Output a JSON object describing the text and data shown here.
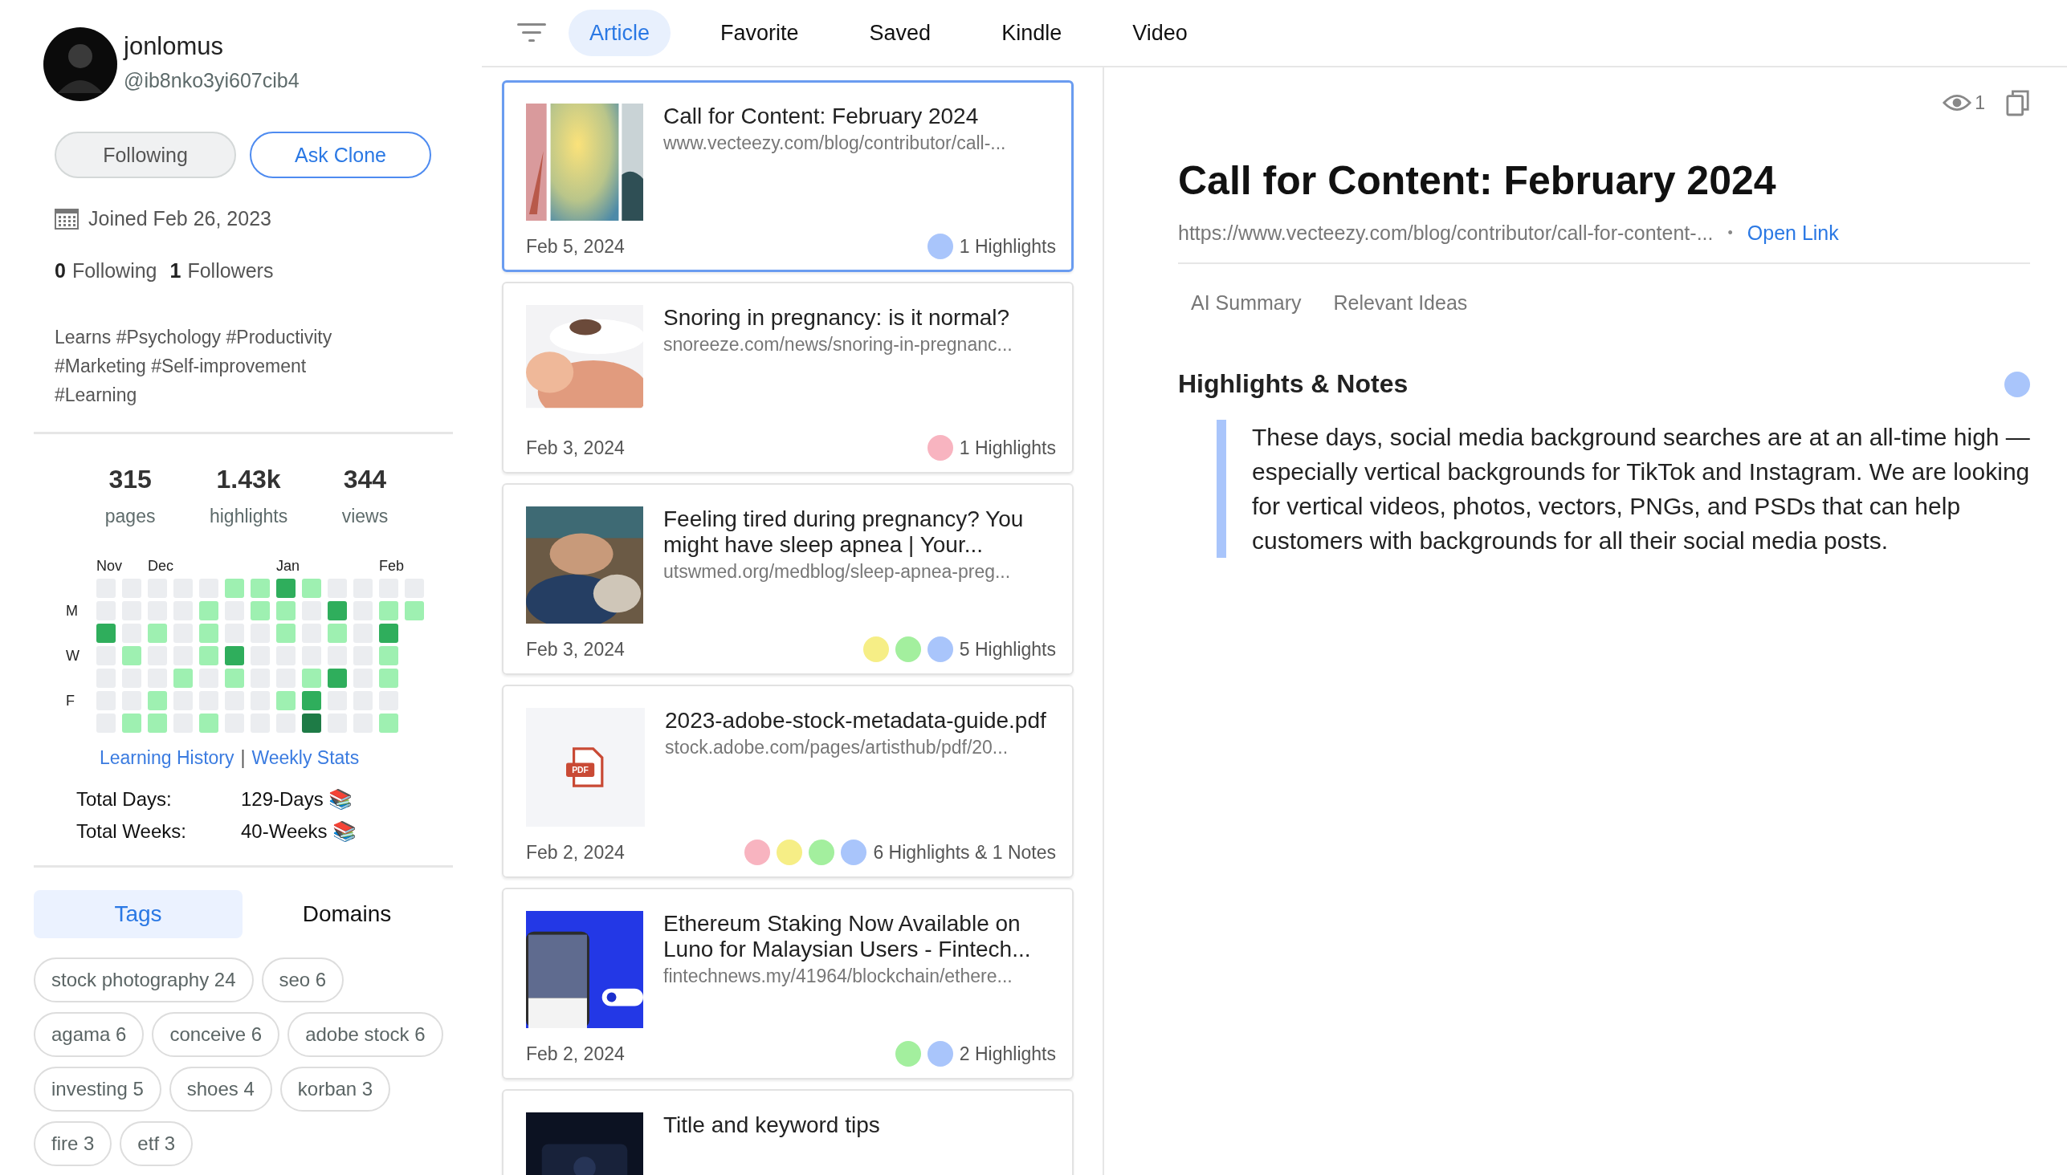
{
  "profile": {
    "name": "jonlomus",
    "handle": "@ib8nko3yi607cib4",
    "buttons": [
      {
        "label": "Following",
        "kind": "secondary"
      },
      {
        "label": "Ask Clone",
        "kind": "primary"
      }
    ],
    "joined": "Joined Feb 26, 2023",
    "following_count": "0",
    "following_label": "Following",
    "followers_count": "1",
    "followers_label": "Followers",
    "bio": "Learns #Psychology #Productivity #Marketing #Self-improvement #Learning"
  },
  "stats": [
    {
      "value": "315",
      "label": "pages"
    },
    {
      "value": "1.43k",
      "label": "highlights"
    },
    {
      "value": "344",
      "label": "views"
    }
  ],
  "activity": {
    "day_labels": [
      "M",
      "W",
      "F"
    ],
    "weeks": [
      {
        "month": "Nov",
        "days": [
          {
            "kind": "none"
          },
          {
            "kind": "none"
          },
          {
            "kind": "medium"
          },
          {
            "kind": "none"
          },
          {
            "kind": "none"
          },
          {
            "kind": "none"
          },
          {
            "kind": "none"
          }
        ]
      },
      {
        "days": [
          {
            "kind": "none"
          },
          {
            "kind": "none"
          },
          {
            "kind": "none"
          },
          {
            "kind": "light"
          },
          {
            "kind": "none"
          },
          {
            "kind": "none"
          },
          {
            "kind": "light"
          }
        ]
      },
      {
        "month": "Dec",
        "days": [
          {
            "kind": "none"
          },
          {
            "kind": "none"
          },
          {
            "kind": "light"
          },
          {
            "kind": "none"
          },
          {
            "kind": "none"
          },
          {
            "kind": "light"
          },
          {
            "kind": "light"
          }
        ]
      },
      {
        "days": [
          {
            "kind": "none"
          },
          {
            "kind": "none"
          },
          {
            "kind": "none"
          },
          {
            "kind": "none"
          },
          {
            "kind": "light"
          },
          {
            "kind": "none"
          },
          {
            "kind": "none"
          }
        ]
      },
      {
        "days": [
          {
            "kind": "none"
          },
          {
            "kind": "light"
          },
          {
            "kind": "light"
          },
          {
            "kind": "light"
          },
          {
            "kind": "none"
          },
          {
            "kind": "none"
          },
          {
            "kind": "light"
          }
        ]
      },
      {
        "days": [
          {
            "kind": "light"
          },
          {
            "kind": "none"
          },
          {
            "kind": "none"
          },
          {
            "kind": "medium"
          },
          {
            "kind": "light"
          },
          {
            "kind": "none"
          },
          {
            "kind": "none"
          }
        ]
      },
      {
        "days": [
          {
            "kind": "light"
          },
          {
            "kind": "light"
          },
          {
            "kind": "none"
          },
          {
            "kind": "none"
          },
          {
            "kind": "none"
          },
          {
            "kind": "none"
          },
          {
            "kind": "none"
          }
        ]
      },
      {
        "month": "Jan",
        "days": [
          {
            "kind": "medium"
          },
          {
            "kind": "light"
          },
          {
            "kind": "light"
          },
          {
            "kind": "none"
          },
          {
            "kind": "none"
          },
          {
            "kind": "light"
          },
          {
            "kind": "none"
          }
        ]
      },
      {
        "days": [
          {
            "kind": "light"
          },
          {
            "kind": "none"
          },
          {
            "kind": "none"
          },
          {
            "kind": "none"
          },
          {
            "kind": "light"
          },
          {
            "kind": "medium"
          },
          {
            "kind": "dark"
          }
        ]
      },
      {
        "days": [
          {
            "kind": "none"
          },
          {
            "kind": "medium"
          },
          {
            "kind": "light"
          },
          {
            "kind": "none"
          },
          {
            "kind": "medium"
          },
          {
            "kind": "none"
          },
          {
            "kind": "none"
          }
        ]
      },
      {
        "days": [
          {
            "kind": "none"
          },
          {
            "kind": "none"
          },
          {
            "kind": "none"
          },
          {
            "kind": "none"
          },
          {
            "kind": "none"
          },
          {
            "kind": "none"
          },
          {
            "kind": "none"
          }
        ]
      },
      {
        "month": "Feb",
        "days": [
          {
            "kind": "none"
          },
          {
            "kind": "light"
          },
          {
            "kind": "medium"
          },
          {
            "kind": "light"
          },
          {
            "kind": "light"
          },
          {
            "kind": "none"
          },
          {
            "kind": "light"
          }
        ]
      },
      {
        "days": [
          {
            "kind": "none"
          },
          {
            "kind": "light"
          }
        ]
      }
    ],
    "links": [
      "Learning History",
      "Weekly Stats"
    ],
    "separator": "|",
    "totals": [
      {
        "label": "Total Days:",
        "value": "129-Days 📚"
      },
      {
        "label": "Total Weeks:",
        "value": "40-Weeks 📚"
      }
    ]
  },
  "side_tabs": [
    {
      "label": "Tags",
      "selected": true
    },
    {
      "label": "Domains",
      "selected": false
    }
  ],
  "tags": [
    "stock photography 24",
    "seo 6",
    "agama 6",
    "conceive 6",
    "adobe stock 6",
    "investing 5",
    "shoes 4",
    "korban 3",
    "fire 3",
    "etf 3"
  ],
  "nav_tabs": [
    {
      "label": "Article",
      "selected": true
    },
    {
      "label": "Favorite",
      "selected": false
    },
    {
      "label": "Saved",
      "selected": false
    },
    {
      "label": "Kindle",
      "selected": false
    },
    {
      "label": "Video",
      "selected": false
    }
  ],
  "articles": [
    {
      "title": "Call for Content: February 2024",
      "url": "www.vecteezy.com/blog/contributor/call-...",
      "date": "Feb 5, 2024",
      "thumb": {
        "kind": "picture"
      },
      "highlights": [
        {
          "color": "#a9c5fb"
        }
      ],
      "count": "1 Highlights",
      "selected": true
    },
    {
      "title": "Snoring in pregnancy: is it normal?",
      "url": "snoreeze.com/news/snoring-in-pregnanc...",
      "date": "Feb 3, 2024",
      "thumb": {
        "kind": "picture"
      },
      "highlights": [
        {
          "color": "#f8b4c0"
        }
      ],
      "count": "1 Highlights",
      "selected": false
    },
    {
      "title": "Feeling tired during pregnancy? You might have sleep apnea | Your...",
      "url": "utswmed.org/medblog/sleep-apnea-preg...",
      "date": "Feb 3, 2024",
      "thumb": {
        "kind": "picture"
      },
      "highlights": [
        {
          "color": "#f6ee86"
        },
        {
          "color": "#a3ef9e"
        },
        {
          "color": "#a9c5fb"
        }
      ],
      "count": "5 Highlights",
      "selected": false
    },
    {
      "title": "2023-adobe-stock-metadata-guide.pdf",
      "url": "stock.adobe.com/pages/artisthub/pdf/20...",
      "date": "Feb 2, 2024",
      "thumb": {
        "kind": "pdf",
        "label": "PDF"
      },
      "highlights": [
        {
          "color": "#f8b4c0"
        },
        {
          "color": "#f6ee86"
        },
        {
          "color": "#a3ef9e"
        },
        {
          "color": "#a9c5fb"
        }
      ],
      "count": "6 Highlights & 1 Notes",
      "selected": false
    },
    {
      "title": "Ethereum Staking Now Available on Luno for Malaysian Users - Fintech...",
      "url": "fintechnews.my/41964/blockchain/ethere...",
      "date": "Feb 2, 2024",
      "thumb": {
        "kind": "picture"
      },
      "highlights": [
        {
          "color": "#a3ef9e"
        },
        {
          "color": "#a9c5fb"
        }
      ],
      "count": "2 Highlights",
      "selected": false
    },
    {
      "title": "Title and keyword tips",
      "thumb": {
        "kind": "picture"
      },
      "selected": false
    }
  ],
  "detail": {
    "views": "1",
    "title": "Call for Content: February 2024",
    "url": "https://www.vecteezy.com/blog/contributor/call-for-content-...",
    "separator": "•",
    "open_link": "Open Link",
    "tabs": [
      {
        "label": "AI Summary",
        "selected": false
      },
      {
        "label": "Relevant Ideas",
        "selected": false
      }
    ],
    "section_title": "Highlights & Notes",
    "notes": [
      {
        "color": "#a9c5fb",
        "text": "These days, social media background searches are at an all-time high — especially vertical backgrounds for TikTok and Instagram. We are looking for vertical videos, photos, vectors, PNGs, and PSDs that can help customers with backgrounds for all their social media posts."
      }
    ]
  }
}
